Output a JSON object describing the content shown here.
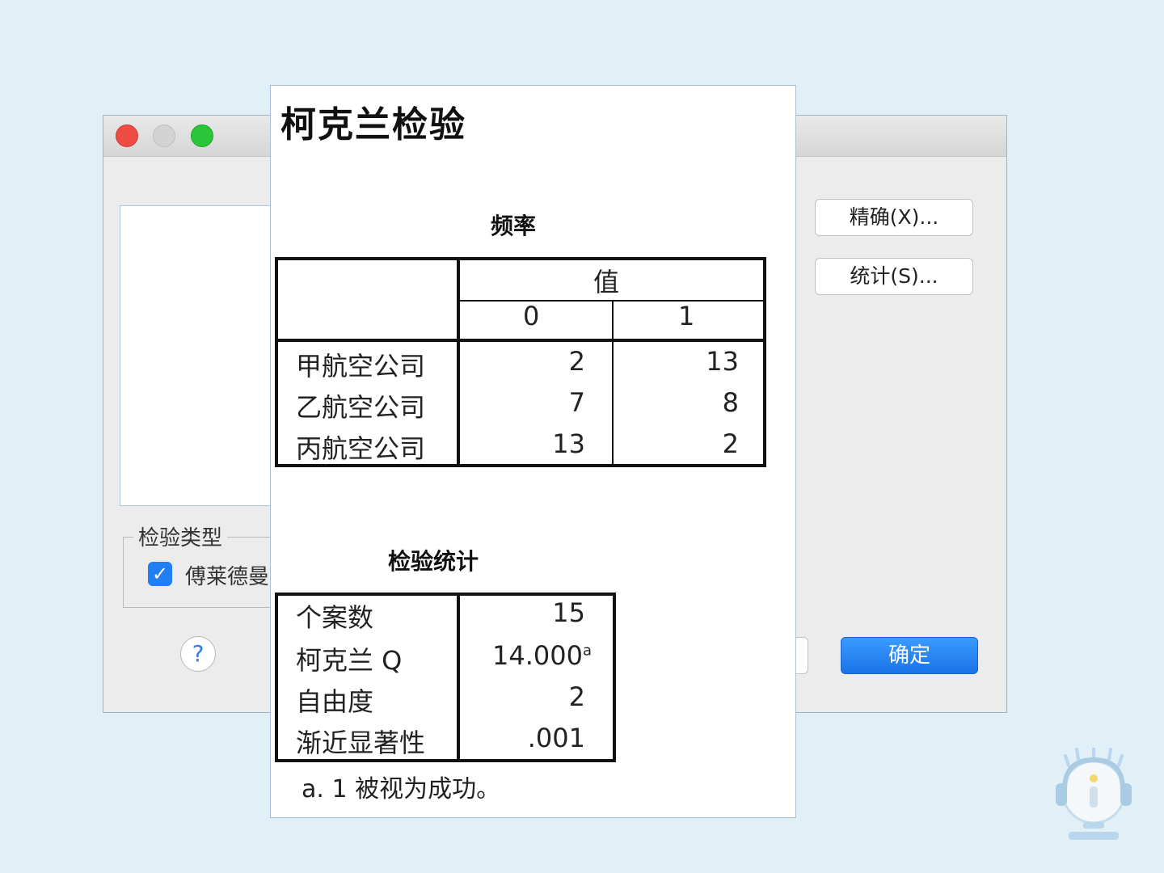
{
  "dialog": {
    "group_label": "检验类型",
    "checkbox_label": "傅莱德曼",
    "checkbox_checked": true,
    "help_label": "?",
    "exact_button": "精确(X)...",
    "stats_button": "统计(S)...",
    "ok_button": "确定"
  },
  "output": {
    "title": "柯克兰检验",
    "freq_caption": "频率",
    "value_header": "值",
    "col_headers": [
      "0",
      "1"
    ],
    "freq_rows": [
      {
        "label": "甲航空公司",
        "v0": "2",
        "v1": "13"
      },
      {
        "label": "乙航空公司",
        "v0": "7",
        "v1": "8"
      },
      {
        "label": "丙航空公司",
        "v0": "13",
        "v1": "2"
      }
    ],
    "stats_caption": "检验统计",
    "stats_rows": [
      {
        "label": "个案数",
        "value": "15",
        "sup": ""
      },
      {
        "label": "柯克兰 Q",
        "value": "14.000",
        "sup": "a"
      },
      {
        "label": "自由度",
        "value": "2",
        "sup": ""
      },
      {
        "label": "渐近显著性",
        "value": ".001",
        "sup": ""
      }
    ],
    "footnote": "a. 1 被视为成功。"
  },
  "colors": {
    "background": "#e1eff7",
    "primary_button": "#1a73e8",
    "checkbox": "#1f7ff3"
  }
}
